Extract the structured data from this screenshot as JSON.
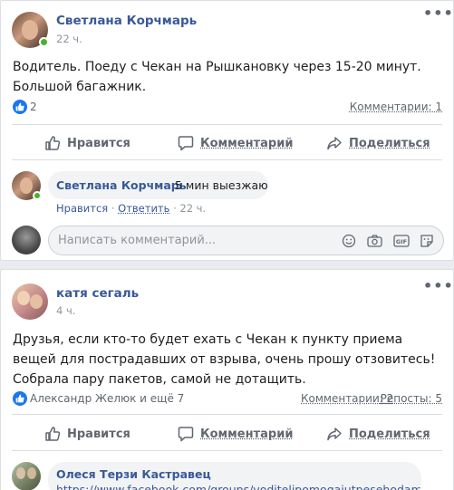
{
  "colors": {
    "link": "#385898",
    "online": "#42b72a",
    "like": "#1877f2",
    "background": "#e9ebee"
  },
  "post1": {
    "author": "Светлана Корчмарь",
    "time": "22 ч.",
    "text": "Водитель. Поеду с Чекан на Рышкановку через 15-20 минут. Большой багажник.",
    "likes_count": "2",
    "comments_link": "Комментарии: 1",
    "actions": {
      "like": "Нравится",
      "comment": "Комментарий",
      "share": "Поделиться"
    },
    "comment": {
      "author": "Светлана Корчмарь",
      "text": "5 мин выезжаю",
      "like": "Нравится",
      "sep1": "·",
      "reply": "Ответить",
      "sep2": "·",
      "time": "22 ч."
    },
    "composer_placeholder": "Написать комментарий..."
  },
  "post2": {
    "author": "катя сегаль",
    "time": "4 ч.",
    "text": "Друзья, если кто-то будет ехать с Чекан к пункту приема вещей для пострадавших от взрыва, очень прошу отзовитесь! Собрала пару пакетов, самой не дотащить.",
    "likes_text": "Александр Желюк и ещё 7",
    "comments_link": "Комментарии: 2",
    "reposts_link": "Репосты: 5",
    "actions": {
      "like": "Нравится",
      "comment": "Комментарий",
      "share": "Поделиться"
    },
    "comment": {
      "author": "Олеся Терзи Кастравец",
      "text": "https://www.facebook.com/groups/voditelipomogaiutpesehodam/per"
    }
  },
  "icons": [
    "more-icon",
    "like-badge-icon",
    "thumbs-up-icon",
    "comment-icon",
    "share-icon",
    "emoji-icon",
    "camera-icon",
    "gif-icon",
    "sticker-icon"
  ]
}
